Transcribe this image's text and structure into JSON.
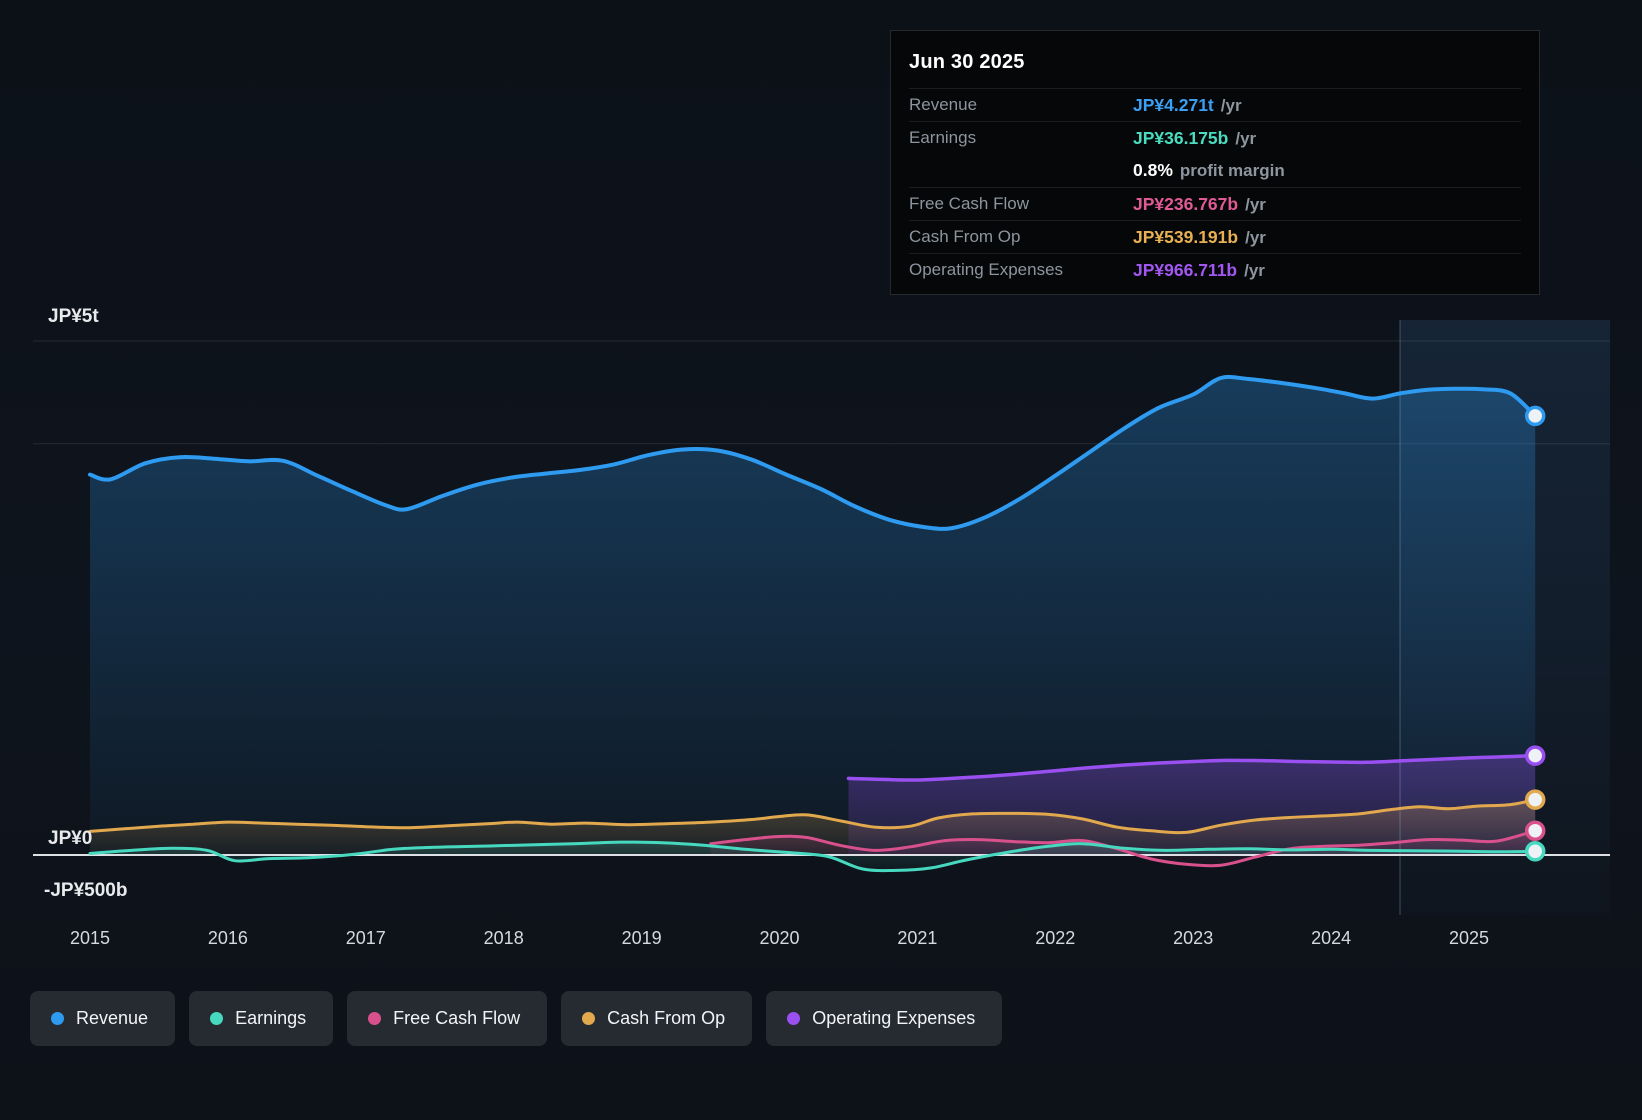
{
  "tooltip": {
    "date": "Jun 30 2025",
    "rows": [
      {
        "label": "Revenue",
        "value": "JP¥4.271t",
        "unit": "/yr",
        "color": "#3aa0f5"
      },
      {
        "label": "Earnings",
        "value": "JP¥36.175b",
        "unit": "/yr",
        "color": "#49dcc0"
      },
      {
        "label": "",
        "value": "0.8%",
        "unit": "profit margin",
        "color": "#ffffff"
      },
      {
        "label": "Free Cash Flow",
        "value": "JP¥236.767b",
        "unit": "/yr",
        "color": "#e05a96"
      },
      {
        "label": "Cash From Op",
        "value": "JP¥539.191b",
        "unit": "/yr",
        "color": "#e8b052"
      },
      {
        "label": "Operating Expenses",
        "value": "JP¥966.711b",
        "unit": "/yr",
        "color": "#a257f2"
      }
    ]
  },
  "axis": {
    "y_labels": [
      {
        "text": "JP¥5t"
      },
      {
        "text": "JP¥0"
      },
      {
        "text": "-JP¥500b"
      }
    ],
    "x_labels": [
      "2015",
      "2016",
      "2017",
      "2018",
      "2019",
      "2020",
      "2021",
      "2022",
      "2023",
      "2024",
      "2025"
    ]
  },
  "legend": [
    {
      "key": "revenue",
      "label": "Revenue",
      "color": "#2e9bf0"
    },
    {
      "key": "earnings",
      "label": "Earnings",
      "color": "#47d9bf"
    },
    {
      "key": "free-cash-flow",
      "label": "Free Cash Flow",
      "color": "#d8518d"
    },
    {
      "key": "cash-from-op",
      "label": "Cash From Op",
      "color": "#e2a84e"
    },
    {
      "key": "operating-expenses",
      "label": "Operating Expenses",
      "color": "#9a50f0"
    }
  ],
  "chart_data": {
    "type": "area",
    "title": "Financial history to Jun 30 2025",
    "x_unit": "year",
    "y_unit": "JP¥ billions",
    "ylim": [
      -500,
      5000
    ],
    "xlim": [
      2015,
      2025.5
    ],
    "grid_values_billions": [
      5000,
      4000,
      0
    ],
    "recent_period_start": 2024.5,
    "series": [
      {
        "key": "revenue",
        "name": "Revenue",
        "color": "#2e9bf0",
        "width": 4,
        "fill_top": 0.3,
        "fill_bottom": 0.04,
        "points": [
          [
            2015.0,
            3700
          ],
          [
            2015.15,
            3655
          ],
          [
            2015.4,
            3810
          ],
          [
            2015.65,
            3870
          ],
          [
            2015.9,
            3855
          ],
          [
            2016.15,
            3830
          ],
          [
            2016.4,
            3835
          ],
          [
            2016.65,
            3690
          ],
          [
            2016.9,
            3540
          ],
          [
            2017.15,
            3400
          ],
          [
            2017.3,
            3365
          ],
          [
            2017.55,
            3490
          ],
          [
            2017.8,
            3600
          ],
          [
            2018.05,
            3670
          ],
          [
            2018.3,
            3710
          ],
          [
            2018.55,
            3745
          ],
          [
            2018.8,
            3800
          ],
          [
            2019.05,
            3890
          ],
          [
            2019.3,
            3945
          ],
          [
            2019.55,
            3935
          ],
          [
            2019.8,
            3845
          ],
          [
            2020.05,
            3700
          ],
          [
            2020.3,
            3560
          ],
          [
            2020.55,
            3390
          ],
          [
            2020.8,
            3260
          ],
          [
            2021.05,
            3190
          ],
          [
            2021.25,
            3180
          ],
          [
            2021.5,
            3290
          ],
          [
            2021.75,
            3470
          ],
          [
            2022.0,
            3690
          ],
          [
            2022.25,
            3920
          ],
          [
            2022.5,
            4150
          ],
          [
            2022.75,
            4350
          ],
          [
            2023.0,
            4480
          ],
          [
            2023.2,
            4640
          ],
          [
            2023.4,
            4630
          ],
          [
            2023.65,
            4590
          ],
          [
            2023.9,
            4540
          ],
          [
            2024.1,
            4490
          ],
          [
            2024.3,
            4440
          ],
          [
            2024.5,
            4490
          ],
          [
            2024.7,
            4525
          ],
          [
            2024.9,
            4535
          ],
          [
            2025.1,
            4530
          ],
          [
            2025.3,
            4490
          ],
          [
            2025.48,
            4271
          ]
        ]
      },
      {
        "key": "operating-expenses",
        "name": "Operating Expenses",
        "color": "#9a50f0",
        "width": 3.5,
        "fill_top": 0.32,
        "fill_bottom": 0.1,
        "points": [
          [
            2020.5,
            745
          ],
          [
            2020.75,
            735
          ],
          [
            2021.0,
            730
          ],
          [
            2021.25,
            745
          ],
          [
            2021.5,
            765
          ],
          [
            2021.75,
            790
          ],
          [
            2022.0,
            820
          ],
          [
            2022.25,
            850
          ],
          [
            2022.5,
            875
          ],
          [
            2022.75,
            895
          ],
          [
            2023.0,
            910
          ],
          [
            2023.25,
            920
          ],
          [
            2023.5,
            918
          ],
          [
            2023.75,
            910
          ],
          [
            2024.0,
            905
          ],
          [
            2024.25,
            902
          ],
          [
            2024.5,
            915
          ],
          [
            2024.75,
            930
          ],
          [
            2025.0,
            945
          ],
          [
            2025.25,
            955
          ],
          [
            2025.48,
            966.711
          ]
        ]
      },
      {
        "key": "cash-from-op",
        "name": "Cash From Op",
        "color": "#e2a84e",
        "width": 3,
        "fill_top": 0.28,
        "fill_bottom": 0.04,
        "points": [
          [
            2015.0,
            230
          ],
          [
            2015.25,
            255
          ],
          [
            2015.5,
            280
          ],
          [
            2015.75,
            300
          ],
          [
            2016.0,
            320
          ],
          [
            2016.25,
            310
          ],
          [
            2016.5,
            300
          ],
          [
            2016.75,
            290
          ],
          [
            2017.0,
            275
          ],
          [
            2017.3,
            265
          ],
          [
            2017.6,
            285
          ],
          [
            2017.9,
            305
          ],
          [
            2018.1,
            320
          ],
          [
            2018.35,
            300
          ],
          [
            2018.6,
            310
          ],
          [
            2018.9,
            295
          ],
          [
            2019.2,
            305
          ],
          [
            2019.5,
            320
          ],
          [
            2019.8,
            345
          ],
          [
            2020.0,
            375
          ],
          [
            2020.2,
            390
          ],
          [
            2020.45,
            330
          ],
          [
            2020.7,
            270
          ],
          [
            2020.95,
            280
          ],
          [
            2021.15,
            360
          ],
          [
            2021.4,
            400
          ],
          [
            2021.7,
            405
          ],
          [
            2021.95,
            395
          ],
          [
            2022.2,
            350
          ],
          [
            2022.45,
            270
          ],
          [
            2022.7,
            235
          ],
          [
            2022.95,
            220
          ],
          [
            2023.2,
            290
          ],
          [
            2023.45,
            340
          ],
          [
            2023.7,
            365
          ],
          [
            2023.95,
            380
          ],
          [
            2024.2,
            400
          ],
          [
            2024.45,
            445
          ],
          [
            2024.65,
            470
          ],
          [
            2024.85,
            450
          ],
          [
            2025.05,
            475
          ],
          [
            2025.3,
            490
          ],
          [
            2025.48,
            539.191
          ]
        ]
      },
      {
        "key": "free-cash-flow",
        "name": "Free Cash Flow",
        "color": "#d8518d",
        "width": 3,
        "fill_top": 0.2,
        "fill_bottom": 0.03,
        "points": [
          [
            2019.5,
            110
          ],
          [
            2019.75,
            150
          ],
          [
            2020.0,
            180
          ],
          [
            2020.2,
            170
          ],
          [
            2020.45,
            90
          ],
          [
            2020.7,
            45
          ],
          [
            2020.95,
            80
          ],
          [
            2021.2,
            140
          ],
          [
            2021.45,
            150
          ],
          [
            2021.7,
            130
          ],
          [
            2021.95,
            120
          ],
          [
            2022.2,
            140
          ],
          [
            2022.45,
            60
          ],
          [
            2022.7,
            -40
          ],
          [
            2022.95,
            -90
          ],
          [
            2023.2,
            -100
          ],
          [
            2023.45,
            -20
          ],
          [
            2023.7,
            60
          ],
          [
            2023.95,
            85
          ],
          [
            2024.2,
            95
          ],
          [
            2024.45,
            120
          ],
          [
            2024.7,
            150
          ],
          [
            2024.95,
            145
          ],
          [
            2025.2,
            135
          ],
          [
            2025.48,
            236.767
          ]
        ]
      },
      {
        "key": "earnings",
        "name": "Earnings",
        "color": "#47d9bf",
        "width": 3,
        "fill_top": 0.18,
        "fill_bottom": 0.03,
        "points": [
          [
            2015.0,
            15
          ],
          [
            2015.3,
            45
          ],
          [
            2015.6,
            65
          ],
          [
            2015.85,
            45
          ],
          [
            2016.05,
            -55
          ],
          [
            2016.3,
            -35
          ],
          [
            2016.6,
            -25
          ],
          [
            2016.9,
            5
          ],
          [
            2017.2,
            55
          ],
          [
            2017.5,
            75
          ],
          [
            2017.8,
            85
          ],
          [
            2018.1,
            95
          ],
          [
            2018.5,
            110
          ],
          [
            2018.85,
            125
          ],
          [
            2019.15,
            120
          ],
          [
            2019.45,
            95
          ],
          [
            2019.75,
            55
          ],
          [
            2020.05,
            25
          ],
          [
            2020.35,
            -15
          ],
          [
            2020.6,
            -135
          ],
          [
            2020.85,
            -150
          ],
          [
            2021.1,
            -125
          ],
          [
            2021.35,
            -50
          ],
          [
            2021.65,
            25
          ],
          [
            2021.95,
            85
          ],
          [
            2022.2,
            110
          ],
          [
            2022.5,
            65
          ],
          [
            2022.8,
            45
          ],
          [
            2023.1,
            55
          ],
          [
            2023.4,
            60
          ],
          [
            2023.7,
            50
          ],
          [
            2024.0,
            55
          ],
          [
            2024.3,
            45
          ],
          [
            2024.6,
            42
          ],
          [
            2024.9,
            38
          ],
          [
            2025.2,
            32
          ],
          [
            2025.48,
            36.175
          ]
        ]
      }
    ]
  }
}
